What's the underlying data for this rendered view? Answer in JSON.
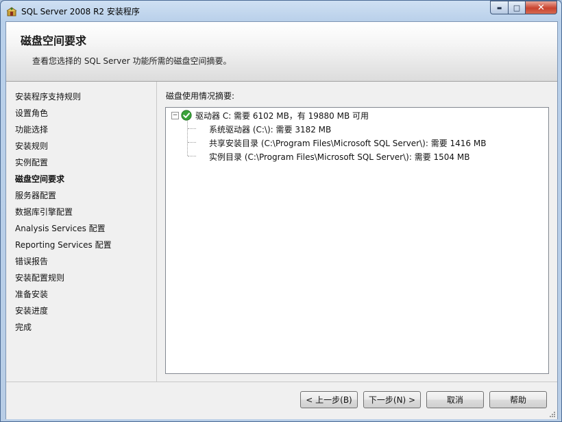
{
  "window": {
    "title": "SQL Server 2008 R2 安装程序",
    "minimize_glyph": "▬",
    "maximize_glyph": "□",
    "close_glyph": "✕"
  },
  "header": {
    "title": "磁盘空间要求",
    "description": "查看您选择的 SQL Server 功能所需的磁盘空间摘要。"
  },
  "sidebar": {
    "items": [
      {
        "label": "安装程序支持规则"
      },
      {
        "label": "设置角色"
      },
      {
        "label": "功能选择"
      },
      {
        "label": "安装规则"
      },
      {
        "label": "实例配置"
      },
      {
        "label": "磁盘空间要求",
        "active": true
      },
      {
        "label": "服务器配置"
      },
      {
        "label": "数据库引擎配置"
      },
      {
        "label": "Analysis Services 配置"
      },
      {
        "label": "Reporting Services 配置"
      },
      {
        "label": "错误报告"
      },
      {
        "label": "安装配置规则"
      },
      {
        "label": "准备安装"
      },
      {
        "label": "安装进度"
      },
      {
        "label": "完成"
      }
    ]
  },
  "main": {
    "summary_label": "磁盘使用情况摘要:",
    "tree": {
      "expander": "−",
      "root": "驱动器 C: 需要 6102 MB，有 19880 MB 可用",
      "children": [
        "系统驱动器 (C:\\): 需要 3182 MB",
        "共享安装目录 (C:\\Program Files\\Microsoft SQL Server\\): 需要 1416 MB",
        "实例目录 (C:\\Program Files\\Microsoft SQL Server\\): 需要 1504 MB"
      ]
    }
  },
  "buttons": {
    "back": "< 上一步(B)",
    "next": "下一步(N) >",
    "cancel": "取消",
    "help": "帮助"
  },
  "colors": {
    "ok_icon": "#3aa33a",
    "title_bar": "#b9d0ea"
  }
}
